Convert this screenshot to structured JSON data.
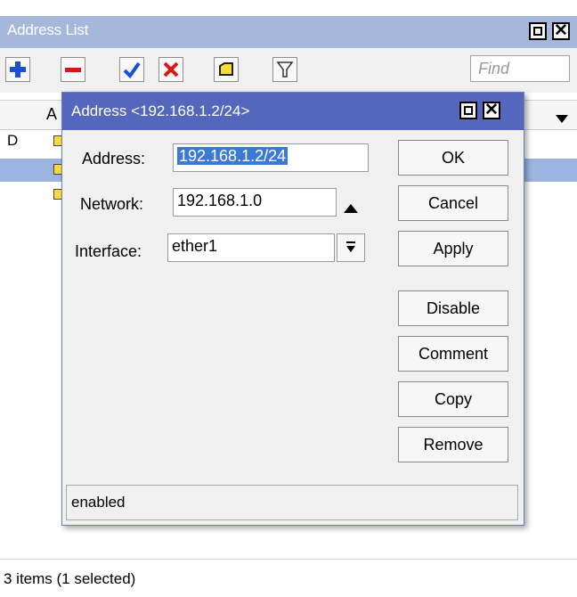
{
  "main_window": {
    "title": "Address List",
    "find_placeholder": "Find",
    "table": {
      "header": {
        "col_a_fragment": "A"
      },
      "rows": [
        {
          "flag": "D",
          "selected": false
        },
        {
          "flag": "",
          "selected": true
        },
        {
          "flag": "",
          "selected": false
        }
      ]
    },
    "status": "3 items (1 selected)"
  },
  "toolbar": {
    "icons": [
      "plus-icon",
      "minus-icon",
      "check-icon",
      "cross-icon",
      "note-icon",
      "filter-icon"
    ]
  },
  "dialog": {
    "title": "Address <192.168.1.2/24>",
    "fields": {
      "address": {
        "label": "Address:",
        "value": "192.168.1.2/24"
      },
      "network": {
        "label": "Network:",
        "value": "192.168.1.0"
      },
      "interface": {
        "label": "Interface:",
        "value": "ether1"
      }
    },
    "buttons": {
      "ok": "OK",
      "cancel": "Cancel",
      "apply": "Apply",
      "disable": "Disable",
      "comment": "Comment",
      "copy": "Copy",
      "remove": "Remove"
    },
    "status": "enabled"
  },
  "colors": {
    "main_titlebar": "#a5b8dc",
    "dialog_titlebar": "#5467bd",
    "selected_row": "#9cb4e2",
    "text_selection": "#3b79d9",
    "add_icon": "#1a4fd6",
    "remove_icon": "#d81818"
  }
}
